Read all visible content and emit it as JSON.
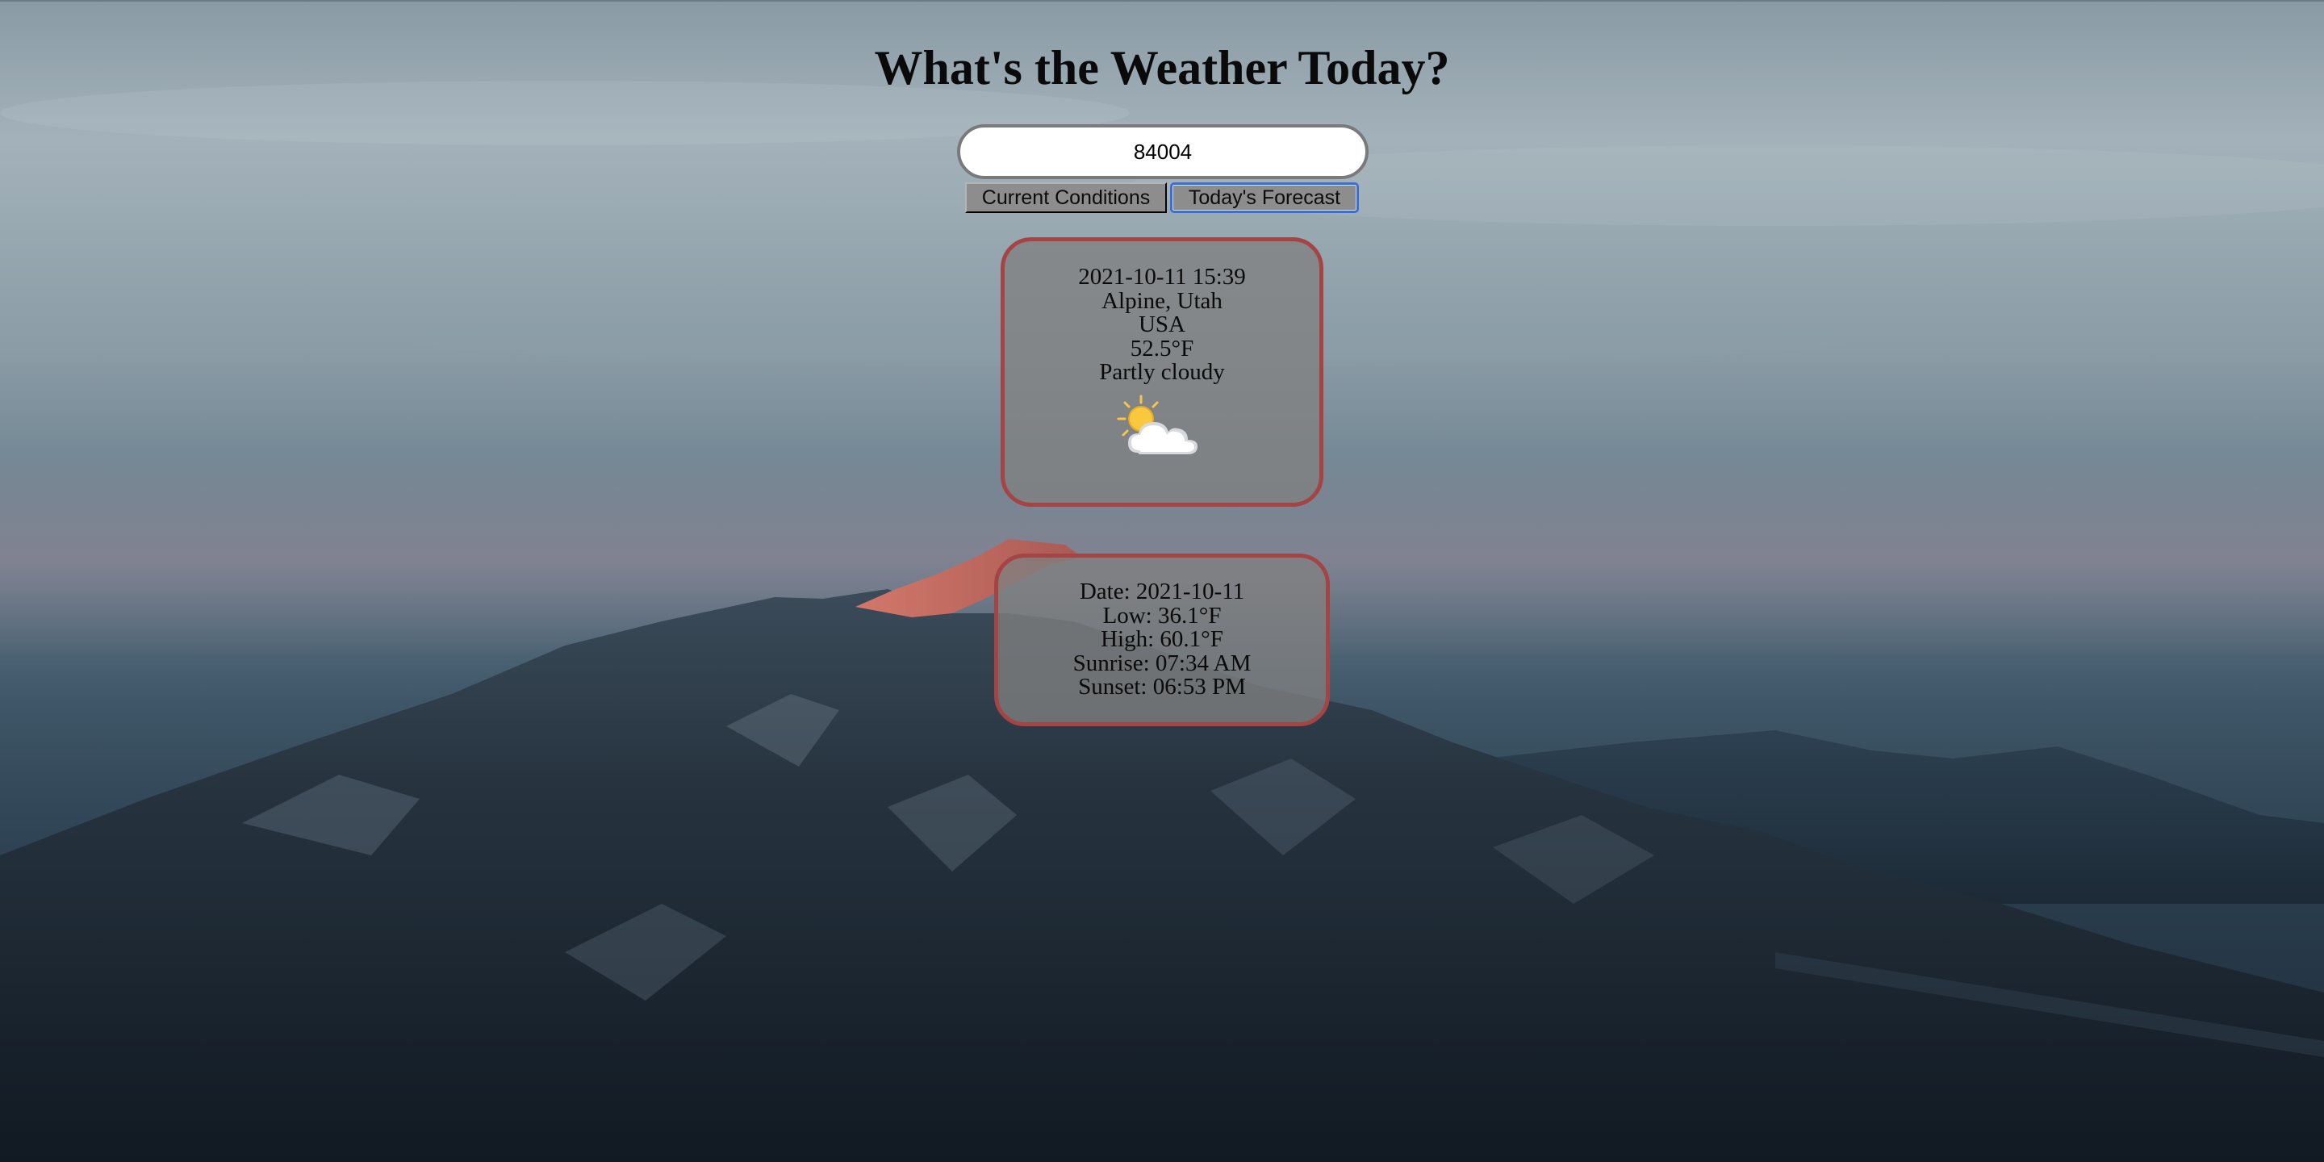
{
  "page": {
    "title": "What's the Weather Today?"
  },
  "search": {
    "value": "84004"
  },
  "buttons": {
    "current_conditions": "Current Conditions",
    "todays_forecast": "Today's Forecast"
  },
  "current": {
    "datetime": "2021-10-11 15:39",
    "location": "Alpine, Utah",
    "country": "USA",
    "temperature": "52.5°F",
    "condition": "Partly cloudy",
    "icon": "partly-cloudy-icon"
  },
  "forecast": {
    "date": "Date: 2021-10-11",
    "low": "Low: 36.1°F",
    "high": "High: 60.1°F",
    "sunrise": "Sunrise: 07:34 AM",
    "sunset": "Sunset: 06:53 PM"
  },
  "colors": {
    "card_border": "#a44444",
    "card_fill": "#808080",
    "active_button_border": "#3d6ed6",
    "sky": "#9eaeb6",
    "mountain": "#1f2b36"
  }
}
